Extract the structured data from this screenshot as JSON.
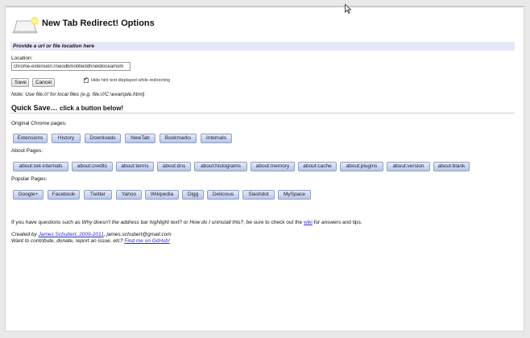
{
  "title": "New Tab Redirect! Options",
  "subheader": "Provide a url or file location here",
  "location": {
    "label": "Location:",
    "value": "chrome-extension://oeodbmobfieddhneldloceamom"
  },
  "buttons": {
    "save": "Save",
    "cancel": "Cancel"
  },
  "hide_hint": {
    "label": "Hide hint text displayed while redirecting",
    "checked": true
  },
  "note": "Note: Use file:/// for local files (e.g. file:///C:\\example.html)",
  "quick_save": {
    "title": "Quick Save…",
    "subtitle": "click a button below!"
  },
  "sections": {
    "chrome": {
      "label": "Original Chrome pages:",
      "buttons": [
        "Extensions",
        "History",
        "Downloads",
        "NewTab",
        "Bookmarks",
        "Internals"
      ]
    },
    "about": {
      "label": "About Pages:",
      "buttons": [
        "about:net-internals",
        "about:credits",
        "about:terms",
        "about:dns",
        "about:histograms",
        "about:memory",
        "about:cache",
        "about:plugins",
        "about:version",
        "about:blank"
      ]
    },
    "popular": {
      "label": "Popular Pages:",
      "buttons": [
        "Google+",
        "Facebook",
        "Twitter",
        "Yahoo",
        "Wikipedia",
        "Digg",
        "Delicious",
        "Slashdot",
        "MySpace"
      ]
    }
  },
  "help": {
    "p1": "If you have questions such as ",
    "q1": "Why doesn't the address bar highlight text?",
    "p2": " or ",
    "q2": "How do I uninstall this?",
    "p3": ", be sure to check out the ",
    "wiki": "wiki",
    "p4": " for answers and tips."
  },
  "credits": {
    "line1_prefix": "Created by ",
    "author_link": "James Schubert, 2009-2011",
    "line1_suffix": ", james.schubert@gmail.com",
    "line2_prefix": "Want to contribute, donate, report an issue, etc? ",
    "github_link": "Find me on GitHub!"
  },
  "colors": {
    "subheader_bg": "#e6e8f8",
    "quick_button_top": "#e5ebf8",
    "quick_button_bottom": "#b8c6e4",
    "link": "#2b2bd2"
  }
}
